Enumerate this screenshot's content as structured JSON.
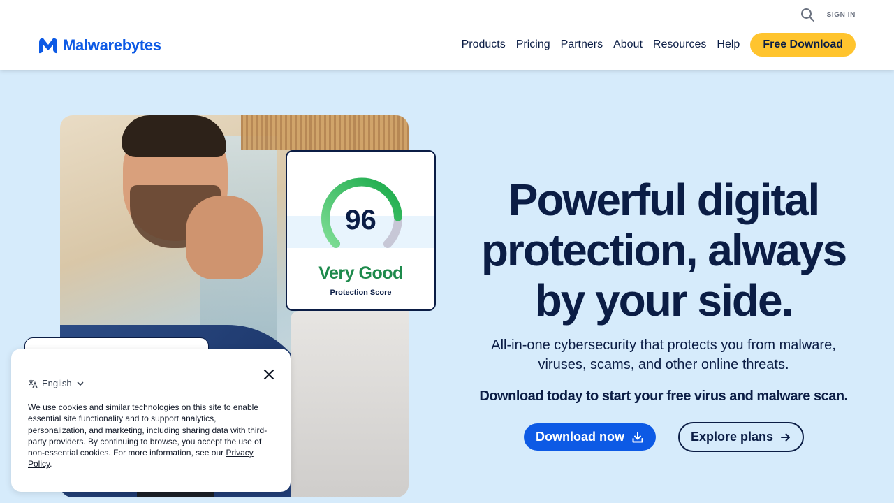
{
  "header": {
    "search_icon": "search-icon",
    "sign_in": "SIGN IN",
    "logo_text": "Malwarebytes",
    "nav": [
      "Products",
      "Pricing",
      "Partners",
      "About",
      "Resources",
      "Help"
    ],
    "cta": "Free Download"
  },
  "score_card": {
    "score": "96",
    "rating": "Very Good",
    "label": "Protection Score",
    "gauge_fraction": 0.96
  },
  "hero": {
    "headline_line1": "Powerful digital",
    "headline_line2": "protection, always",
    "headline_line3": "by your side.",
    "sub_line1": "All-in-one cybersecurity that protects you from malware,",
    "sub_line2": "viruses, scams, and other online threats.",
    "sub_bold": "Download today to start your free virus and malware scan.",
    "primary_button": "Download now",
    "secondary_button": "Explore plans"
  },
  "cookie": {
    "language": "English",
    "text": "We use cookies and similar technologies on this site to enable essential site functionality and to support analytics, personalization, and marketing, including sharing data with third-party providers. By continuing to browse, you accept the use of non-essential cookies. For more information, see our ",
    "policy_link": "Privacy Policy",
    "period": "."
  },
  "colors": {
    "brand_blue": "#0d5ae5",
    "navy": "#0b1d45",
    "cta_yellow": "#ffc42e",
    "hero_bg": "#d6ebfb",
    "rating_green": "#1e8a4c"
  }
}
